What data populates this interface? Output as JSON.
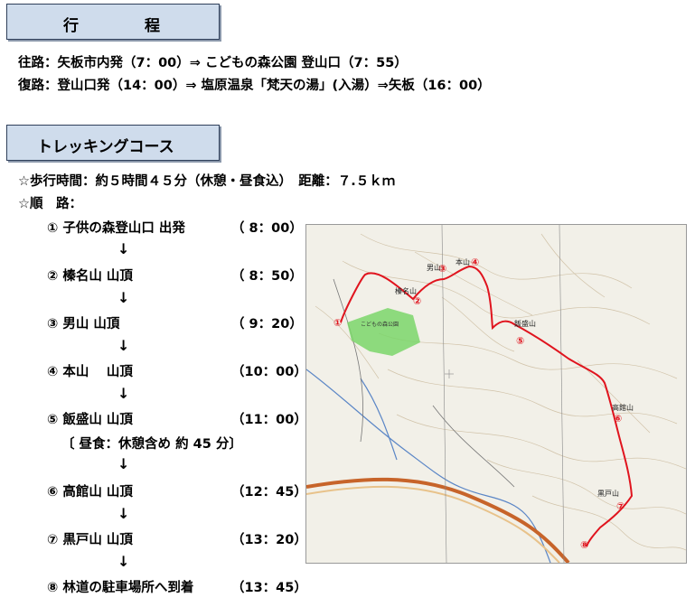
{
  "schedule": {
    "title_chars": [
      "行",
      "程"
    ],
    "outbound": "往路：矢板市内発（7：00）⇒ こどもの森公園 登山口（7：55）",
    "return": "復路：登山口発（14：00）⇒ 塩原温泉「梵天の湯」(入湯）⇒矢板（16：00）"
  },
  "course": {
    "title": "トレッキングコース",
    "walk_time": "☆歩行時間：約５時間４５分（休憩・昼食込）　距離：７.５ｋｍ",
    "route_label": "☆順　路：",
    "arrow": "↓",
    "lunch": "〔 昼食：休憩含め 約 45 分〕",
    "steps": [
      {
        "num": "①",
        "name": "子供の森登山口 出発",
        "time": "（ 8：00）"
      },
      {
        "num": "②",
        "name": "榛名山 山頂",
        "time": "（ 8：50）"
      },
      {
        "num": "③",
        "name": "男山 山頂",
        "time": "（ 9：20）"
      },
      {
        "num": "④",
        "name": "本山　  山頂",
        "time": "（10：00）"
      },
      {
        "num": "⑤",
        "name": "飯盛山 山頂",
        "time": "（11：00）"
      },
      {
        "num": "⑥",
        "name": "高館山 山頂",
        "time": "（12：45）"
      },
      {
        "num": "⑦",
        "name": "黒戸山 山頂",
        "time": "（13：20）"
      },
      {
        "num": "⑧",
        "name": "林道の駐車場所へ到着",
        "time": "（13：45）"
      }
    ]
  },
  "map": {
    "labels": {
      "harunasan": "榛名山",
      "otokoyama": "男山",
      "motoyama": "本山",
      "iimoriyama": "飯盛山",
      "takadateyama": "高館山",
      "kurotoyama": "黒戸山",
      "park": "こどもの森公園"
    },
    "markers": [
      "①",
      "②",
      "③",
      "④",
      "⑤",
      "⑥",
      "⑦",
      "⑧"
    ],
    "route_color": "#e0141e",
    "park_color": "#7bd66a"
  }
}
